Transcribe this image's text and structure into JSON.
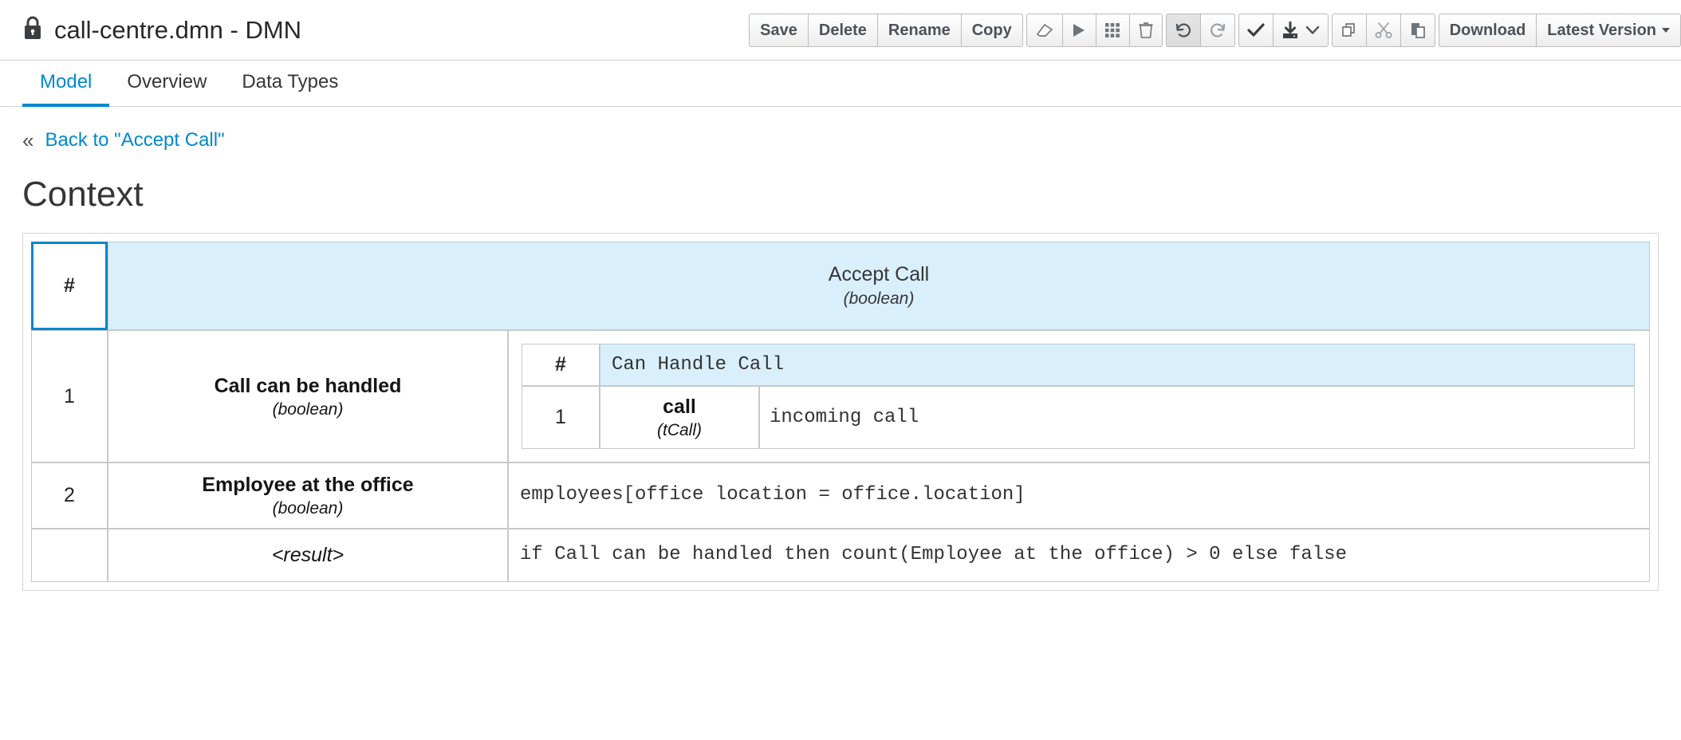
{
  "header": {
    "lock_icon": "lock-icon",
    "document_title": "call-centre.dmn - DMN",
    "toolbar": {
      "save_label": "Save",
      "delete_label": "Delete",
      "rename_label": "Rename",
      "copy_label": "Copy",
      "eraser_icon": "eraser-icon",
      "play_icon": "play-icon",
      "grid_icon": "grid-icon",
      "trash_icon": "trash-icon",
      "undo_icon": "undo-icon",
      "redo_icon": "redo-icon",
      "check_icon": "check-icon",
      "download_save_icon": "download-save-icon",
      "download_save_caret": "chevron-down-icon",
      "copy_pages_icon": "copy-pages-icon",
      "cut_icon": "scissors-cut-icon",
      "paste_icon": "paste-icon",
      "download_label": "Download",
      "latest_version_label": "Latest Version"
    }
  },
  "tabs": [
    {
      "label": "Model",
      "active": true
    },
    {
      "label": "Overview",
      "active": false
    },
    {
      "label": "Data Types",
      "active": false
    }
  ],
  "breadcrumb": {
    "chevrons": "«",
    "back_label": "Back to \"Accept Call\""
  },
  "page_title": "Context",
  "colors": {
    "accent_blue": "#0088ce",
    "header_fill": "#daeffc",
    "selection_border": "#0088ce",
    "grid_line": "#c8c8c8"
  },
  "expression": {
    "index_header": "#",
    "header": {
      "name": "Accept Call",
      "type": "(boolean)"
    },
    "rows": [
      {
        "index": "1",
        "name": "Call can be handled",
        "type": "(boolean)",
        "nested": {
          "index_header": "#",
          "header_expression": "Can Handle Call",
          "rows": [
            {
              "index": "1",
              "name": "call",
              "type": "(tCall)",
              "expression": "incoming call"
            }
          ]
        }
      },
      {
        "index": "2",
        "name": "Employee at the office",
        "type": "(boolean)",
        "expression": "employees[office location = office.location]"
      },
      {
        "index": "",
        "name": "<result>",
        "type": "",
        "expression": "if Call can be handled then count(Employee at the office) > 0  else false"
      }
    ]
  }
}
